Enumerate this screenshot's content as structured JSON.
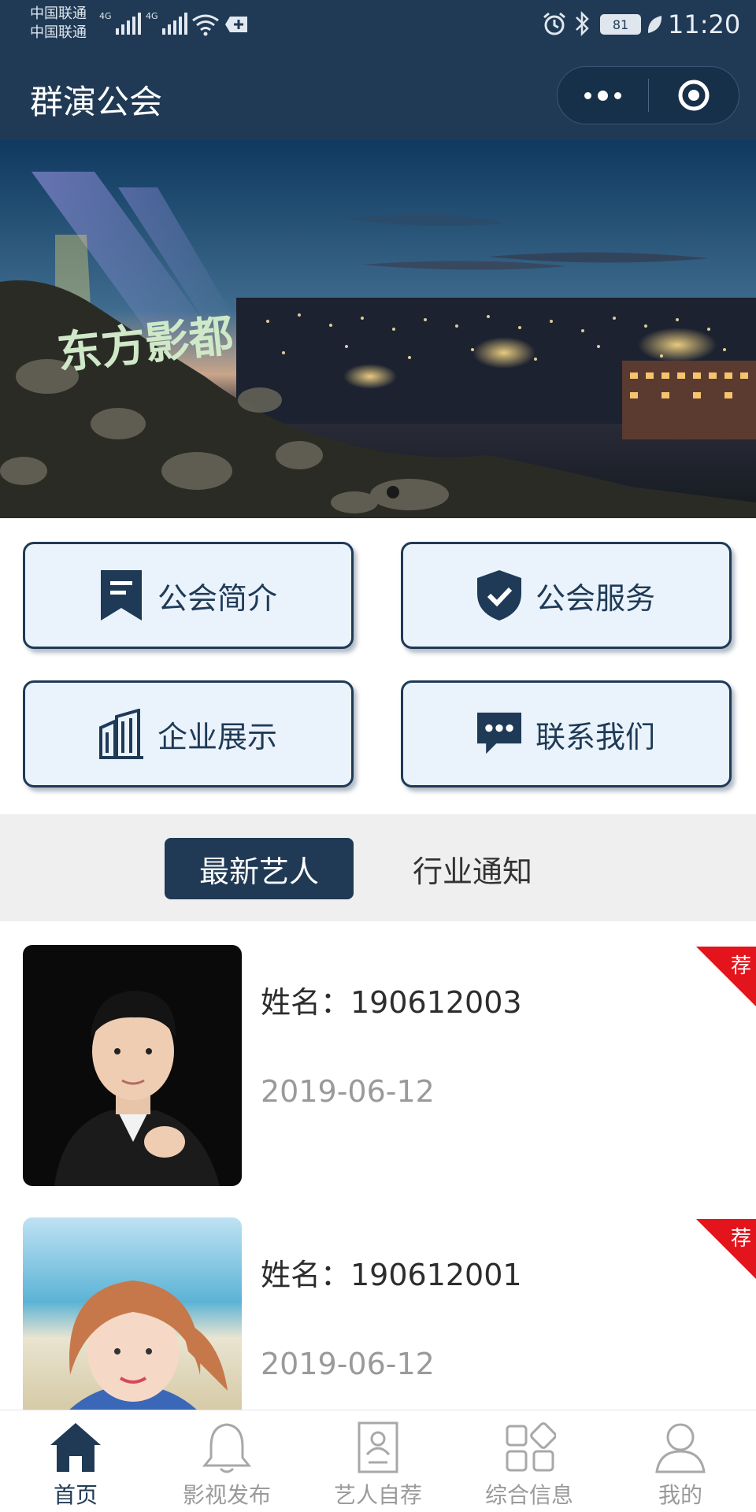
{
  "status_bar": {
    "carrier_1": "中国联通",
    "carrier_2": "中国联通",
    "signal_label_1": "4G",
    "signal_label_2": "4G",
    "battery": "81",
    "time": "11:20"
  },
  "header": {
    "title": "群演公会"
  },
  "banner": {
    "overlay_text": "东方影都"
  },
  "menu": {
    "items": [
      {
        "label": "公会简介",
        "icon": "bookmark-icon"
      },
      {
        "label": "公会服务",
        "icon": "shield-check-icon"
      },
      {
        "label": "企业展示",
        "icon": "building-icon"
      },
      {
        "label": "联系我们",
        "icon": "chat-bubble-icon"
      }
    ]
  },
  "tabs": [
    {
      "label": "最新艺人",
      "active": true
    },
    {
      "label": "行业通知",
      "active": false
    }
  ],
  "artists": [
    {
      "name": "姓名：190612003",
      "date": "2019-06-12",
      "badge": "荐"
    },
    {
      "name": "姓名：190612001",
      "date": "2019-06-12",
      "badge": "荐"
    }
  ],
  "bottom_nav": [
    {
      "label": "首页",
      "icon": "home-icon",
      "active": true
    },
    {
      "label": "影视发布",
      "icon": "bell-icon",
      "active": false
    },
    {
      "label": "艺人自荐",
      "icon": "id-card-icon",
      "active": false
    },
    {
      "label": "综合信息",
      "icon": "grid-icon",
      "active": false
    },
    {
      "label": "我的",
      "icon": "user-icon",
      "active": false
    }
  ],
  "colors": {
    "primary": "#203a55",
    "badge": "#e3141b",
    "button_bg": "#eaf3fb",
    "tab_bar_bg": "#efefef"
  }
}
